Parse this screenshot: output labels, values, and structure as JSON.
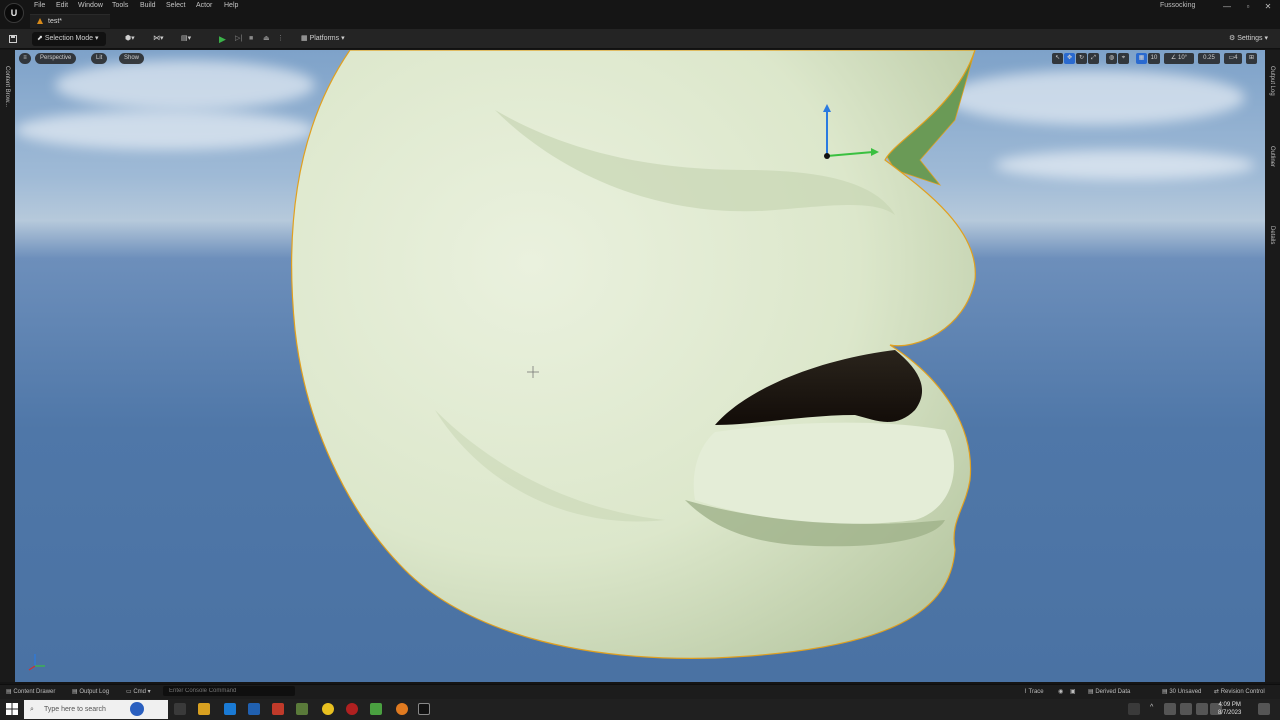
{
  "menu": {
    "logo": "U",
    "items": [
      "File",
      "Edit",
      "Window",
      "Tools",
      "Build",
      "Select",
      "Actor",
      "Help"
    ],
    "tab_title": "test*",
    "project_name": "Fussocking",
    "win_min": "—",
    "win_max": "▫",
    "win_close": "✕"
  },
  "toolbar": {
    "selection_mode": "Selection Mode",
    "platforms": "Platforms",
    "settings": "Settings"
  },
  "viewport": {
    "menu_icon": "≡",
    "perspective": "Perspective",
    "lit": "Lit",
    "show": "Show",
    "grid_snap": "10",
    "rotation_snap": "10°",
    "scale_snap": "0.25",
    "camera_speed": "4"
  },
  "sidebars": {
    "left_label": "Content Brow...",
    "right_labels": [
      "Output Log",
      "Outliner",
      "Details"
    ]
  },
  "statusbar": {
    "content_drawer": "Content Drawer",
    "output_log": "Output Log",
    "cmd": "Cmd",
    "console_placeholder": "Enter Console Command",
    "trace": "Trace",
    "derived_data": "Derived Data",
    "unsaved": "30 Unsaved",
    "revision_control": "Revision Control"
  },
  "taskbar": {
    "search_placeholder": "Type here to search",
    "time": "4:09 PM",
    "date": "8/7/2023"
  },
  "colors": {
    "accent_play": "#3bb34a",
    "selection_outline": "#e0a020",
    "mesh": "#dfe9d2"
  }
}
